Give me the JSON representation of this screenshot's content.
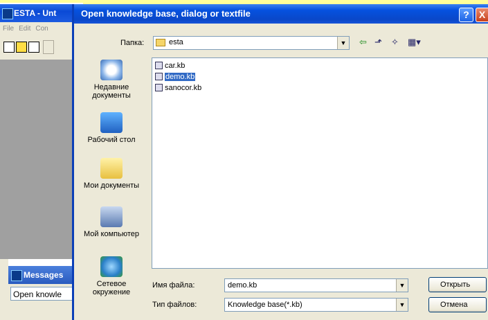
{
  "app": {
    "title": "ESTA - Unt",
    "menu": [
      "File",
      "Edit",
      "Con"
    ],
    "messages_title": "Messages",
    "messages_text": "Open knowle"
  },
  "dialog": {
    "title": "Open knowledge base, dialog or textfile",
    "help_label": "?",
    "close_label": "X",
    "folder_label": "Папка:",
    "folder_value": "esta",
    "places": [
      "Недавние документы",
      "Рабочий стол",
      "Мои документы",
      "Мой компьютер",
      "Сетевое окружение"
    ],
    "files": [
      "car.kb",
      "demo.kb",
      "sanocor.kb"
    ],
    "selected_file": "demo.kb",
    "filename_label": "Имя файла:",
    "filename_value": "demo.kb",
    "filetype_label": "Тип файлов:",
    "filetype_value": "Knowledge base(*.kb)",
    "open_button": "Открыть",
    "cancel_button": "Отмена"
  }
}
